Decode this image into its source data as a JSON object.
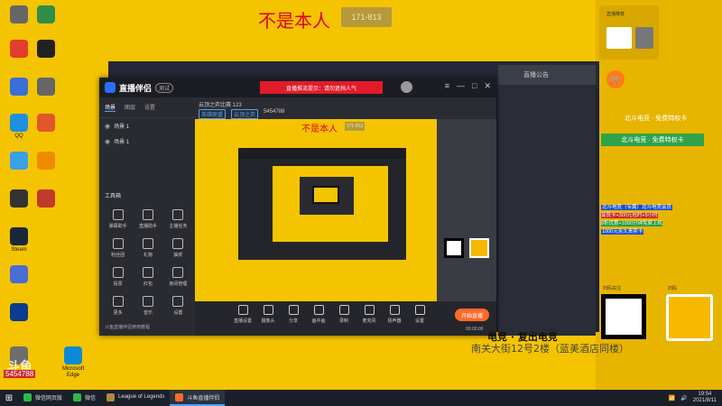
{
  "overlay": {
    "title": "不是本人",
    "tag": "171-813",
    "address_line1": "电竞 · 复出电竞",
    "address_line2": "南关大街12号2楼（蓝美酒店同楼）",
    "counter": "5454788"
  },
  "desktop_icons": [
    {
      "label": "",
      "icon": "app-icon",
      "color": "#666666"
    },
    {
      "label": "",
      "icon": "app-icon",
      "color": "#2f8f4a"
    },
    {
      "label": "",
      "icon": "chrome-icon",
      "color": "#e23d2d"
    },
    {
      "label": "",
      "icon": "terminal-icon",
      "color": "#222222"
    },
    {
      "label": "",
      "icon": "computer-icon",
      "color": "#3a6fd8"
    },
    {
      "label": "",
      "icon": "file-icon",
      "color": "#666666"
    },
    {
      "label": "QQ",
      "icon": "qq-icon",
      "color": "#1f8fe0"
    },
    {
      "label": "",
      "icon": "app-icon",
      "color": "#e0572a"
    },
    {
      "label": "",
      "icon": "cloud-icon",
      "color": "#3aa0e8"
    },
    {
      "label": "",
      "icon": "app-icon",
      "color": "#f08a00"
    },
    {
      "label": "",
      "icon": "game-icon",
      "color": "#333333"
    },
    {
      "label": "",
      "icon": "game-icon",
      "color": "#c0392b"
    },
    {
      "label": "Steam",
      "icon": "steam-icon",
      "color": "#1b2838"
    },
    {
      "label": "",
      "icon": "app-icon",
      "color": "#4a6cd4"
    },
    {
      "label": "",
      "icon": "app-icon",
      "color": "#0a3d8f"
    },
    {
      "label": "",
      "icon": "app-icon",
      "color": "#6d6d6d"
    },
    {
      "label": "Microsoft Edge",
      "icon": "edge-icon",
      "color": "#0b8bd6"
    }
  ],
  "app": {
    "name": "直播伴侣",
    "version": "测试",
    "notice": "直播推流提示：请勿遮挡人气",
    "left_tabs": [
      "场景",
      "图层",
      "设置"
    ],
    "scenes": [
      "场景 1",
      "场景 1"
    ],
    "tools_title": "工具箱",
    "tools": [
      "弹幕助手",
      "直播助手",
      "主播任务",
      "粉丝团",
      "礼物",
      "抽奖",
      "投票",
      "红包",
      "房间管理",
      "更多",
      "音乐",
      "设置"
    ],
    "bottom_text": "斗鱼直播伴侣使用教程",
    "preview_title": "云顶之弈比赛 123",
    "preview_meta": [
      "英雄联盟",
      "云顶之弈"
    ],
    "preview_ids": [
      "5454788"
    ],
    "controls": [
      "直播设置",
      "摄像头",
      "分享",
      "画中画",
      "录制",
      "麦克风",
      "扬声器",
      "设置"
    ],
    "live_button": "开始直播",
    "timer": "00:00:00"
  },
  "right_panel": {
    "top_label": "直播推荐",
    "shop_title": "北斗电竞 · 免费特权卡",
    "green_banner": "北斗电竞 · 免费特权卡",
    "promo": [
      "北斗电竞（专属）北斗电竞会员",
      "会员卡+300元包时+5小时",
      "8折优惠+1000分钟免费上机",
      "1000元永久贵宾卡"
    ],
    "qr_left_label": "扫码关注",
    "qr_right_label": "扫码"
  },
  "taskbar": {
    "items": [
      {
        "label": "微信网页版",
        "icon": "wechat-icon",
        "color": "#2fb84a"
      },
      {
        "label": "微信",
        "icon": "wechat-icon",
        "color": "#2fb84a"
      },
      {
        "label": "League of Legends",
        "icon": "lol-icon",
        "color": "#b08a3a"
      },
      {
        "label": "斗鱼直播伴侣",
        "icon": "douyu-icon",
        "color": "#ff6a2b"
      }
    ],
    "time": "19:54",
    "date": "2021/8/11"
  }
}
